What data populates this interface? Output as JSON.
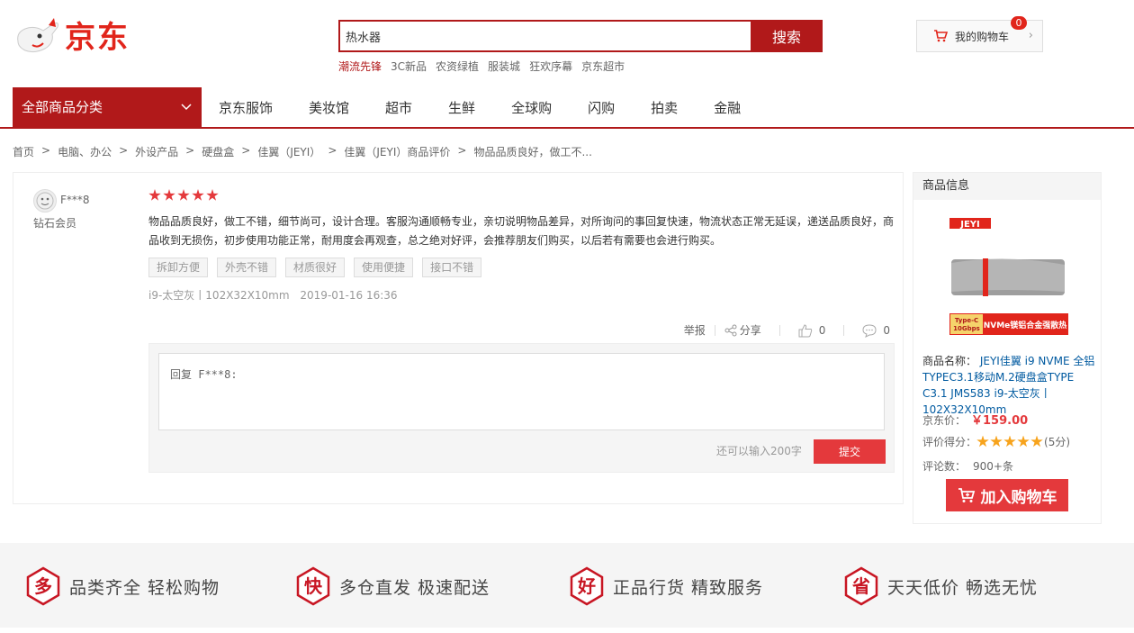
{
  "header": {
    "logo_text": "京东",
    "search": {
      "value": "热水器",
      "button_label": "搜索"
    },
    "hotwords": [
      "潮流先锋",
      "3C新品",
      "农资绿植",
      "服装城",
      "狂欢序幕",
      "京东超市"
    ],
    "cart": {
      "label": "我的购物车",
      "count": "0"
    }
  },
  "nav": {
    "category_label": "全部商品分类",
    "items": [
      "京东服饰",
      "美妆馆",
      "超市",
      "生鲜",
      "全球购",
      "闪购",
      "拍卖",
      "金融"
    ]
  },
  "breadcrumb": [
    "首页",
    "电脑、办公",
    "外设产品",
    "硬盘盒",
    "佳翼（JEYI）",
    "佳翼（JEYI）商品评价",
    "物品品质良好，做工不..."
  ],
  "review": {
    "user": "F***8",
    "level": "钻石会员",
    "rating": 5,
    "content": "物品品质良好，做工不错，细节尚可，设计合理。客服沟通顺畅专业，亲切说明物品差异，对所询问的事回复快速，物流状态正常无延误，递送品质良好，商品收到无损伤，初步使用功能正常，耐用度会再观查，总之绝对好评，会推荐朋友们购买，以后若有需要也会进行购买。",
    "tags": [
      "拆卸方便",
      "外壳不错",
      "材质很好",
      "使用便捷",
      "接口不错"
    ],
    "variant": "i9-太空灰丨102X32X10mm",
    "date": "2019-01-16 16:36",
    "actions": {
      "report": "举报",
      "share": "分享",
      "likes": "0",
      "comments": "0"
    },
    "reply": {
      "text": "回复 F***8:",
      "hint": "还可以输入200字",
      "submit": "提交"
    }
  },
  "product": {
    "heading": "商品信息",
    "brand_badge": "JEYI",
    "product_label": "NVMe镁铝合金强散热",
    "tech_badge_1": "Type-C",
    "tech_badge_2": "10Gbps",
    "name_label": "商品名称：",
    "name": "JEYI佳翼 i9 NVME 全铝TYPEC3.1移动M.2硬盘盒TYPE C3.1 JMS583 i9-太空灰丨102X32X10mm",
    "price_label": "京东价：",
    "price": "￥159.00",
    "score_label": "评价得分：",
    "score": "(5分)",
    "score_stars": 5,
    "count_label": "评论数：",
    "count": "900+条",
    "add_cart": "加入购物车"
  },
  "footer": {
    "promises": [
      {
        "icon": "多",
        "text": "品类齐全  轻松购物"
      },
      {
        "icon": "快",
        "text": "多仓直发  极速配送"
      },
      {
        "icon": "好",
        "text": "正品行货  精致服务"
      },
      {
        "icon": "省",
        "text": "天天低价  畅选无忧"
      }
    ]
  },
  "colors": {
    "brand_red": "#e1251b",
    "dark_red": "#b1191a",
    "button_red": "#e4393c",
    "star_gold": "#f7a31c",
    "link_blue": "#005aa0"
  }
}
